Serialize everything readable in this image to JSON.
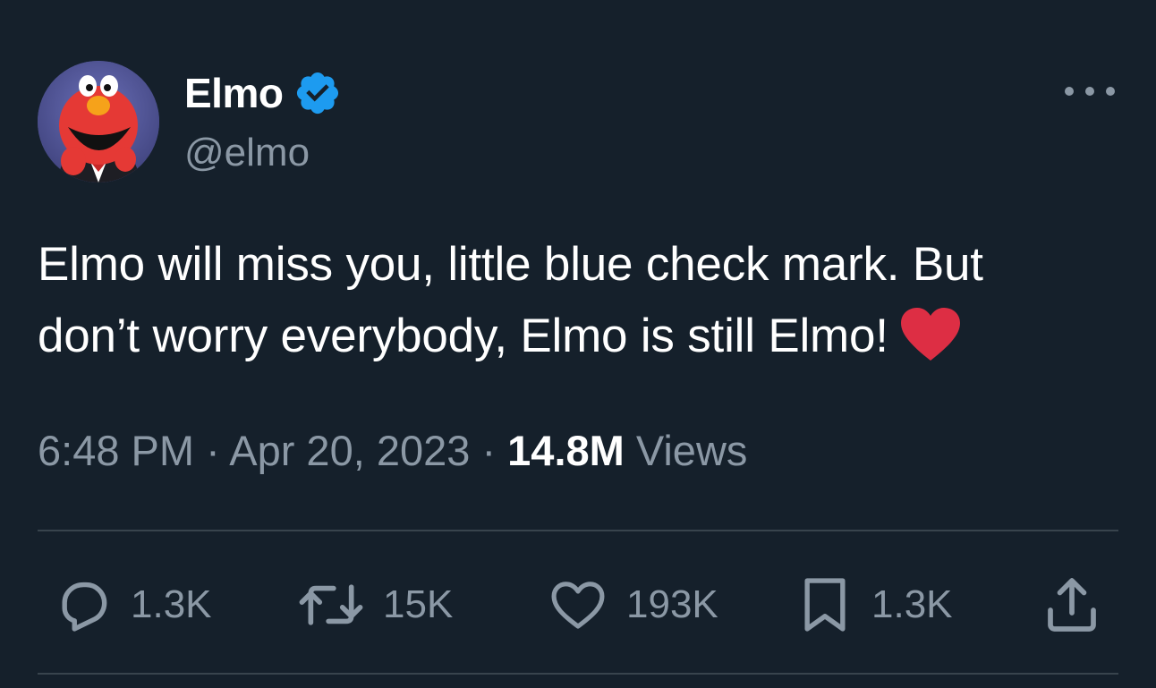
{
  "user": {
    "display_name": "Elmo",
    "handle": "@elmo",
    "verified": true,
    "avatar_icon": "elmo-avatar"
  },
  "tweet": {
    "text_line1": "Elmo will miss you, little blue check mark. But",
    "text_line2": "don’t worry everybody, Elmo is still Elmo!",
    "emoji": "red-heart"
  },
  "meta": {
    "time": "6:48 PM",
    "separator": " · ",
    "date": "Apr 20, 2023",
    "views_count": "14.8M",
    "views_label": " Views"
  },
  "actions": {
    "reply": {
      "icon": "reply-icon",
      "count": "1.3K"
    },
    "retweet": {
      "icon": "retweet-icon",
      "count": "15K"
    },
    "like": {
      "icon": "heart-icon",
      "count": "193K"
    },
    "bookmark": {
      "icon": "bookmark-icon",
      "count": "1.3K"
    },
    "share": {
      "icon": "share-icon"
    }
  },
  "colors": {
    "background": "#15202b",
    "text_primary": "#ffffff",
    "text_secondary": "#8b98a5",
    "divider": "#38444d",
    "verified_blue": "#1d9bf0",
    "heart_red": "#dd2e44"
  }
}
